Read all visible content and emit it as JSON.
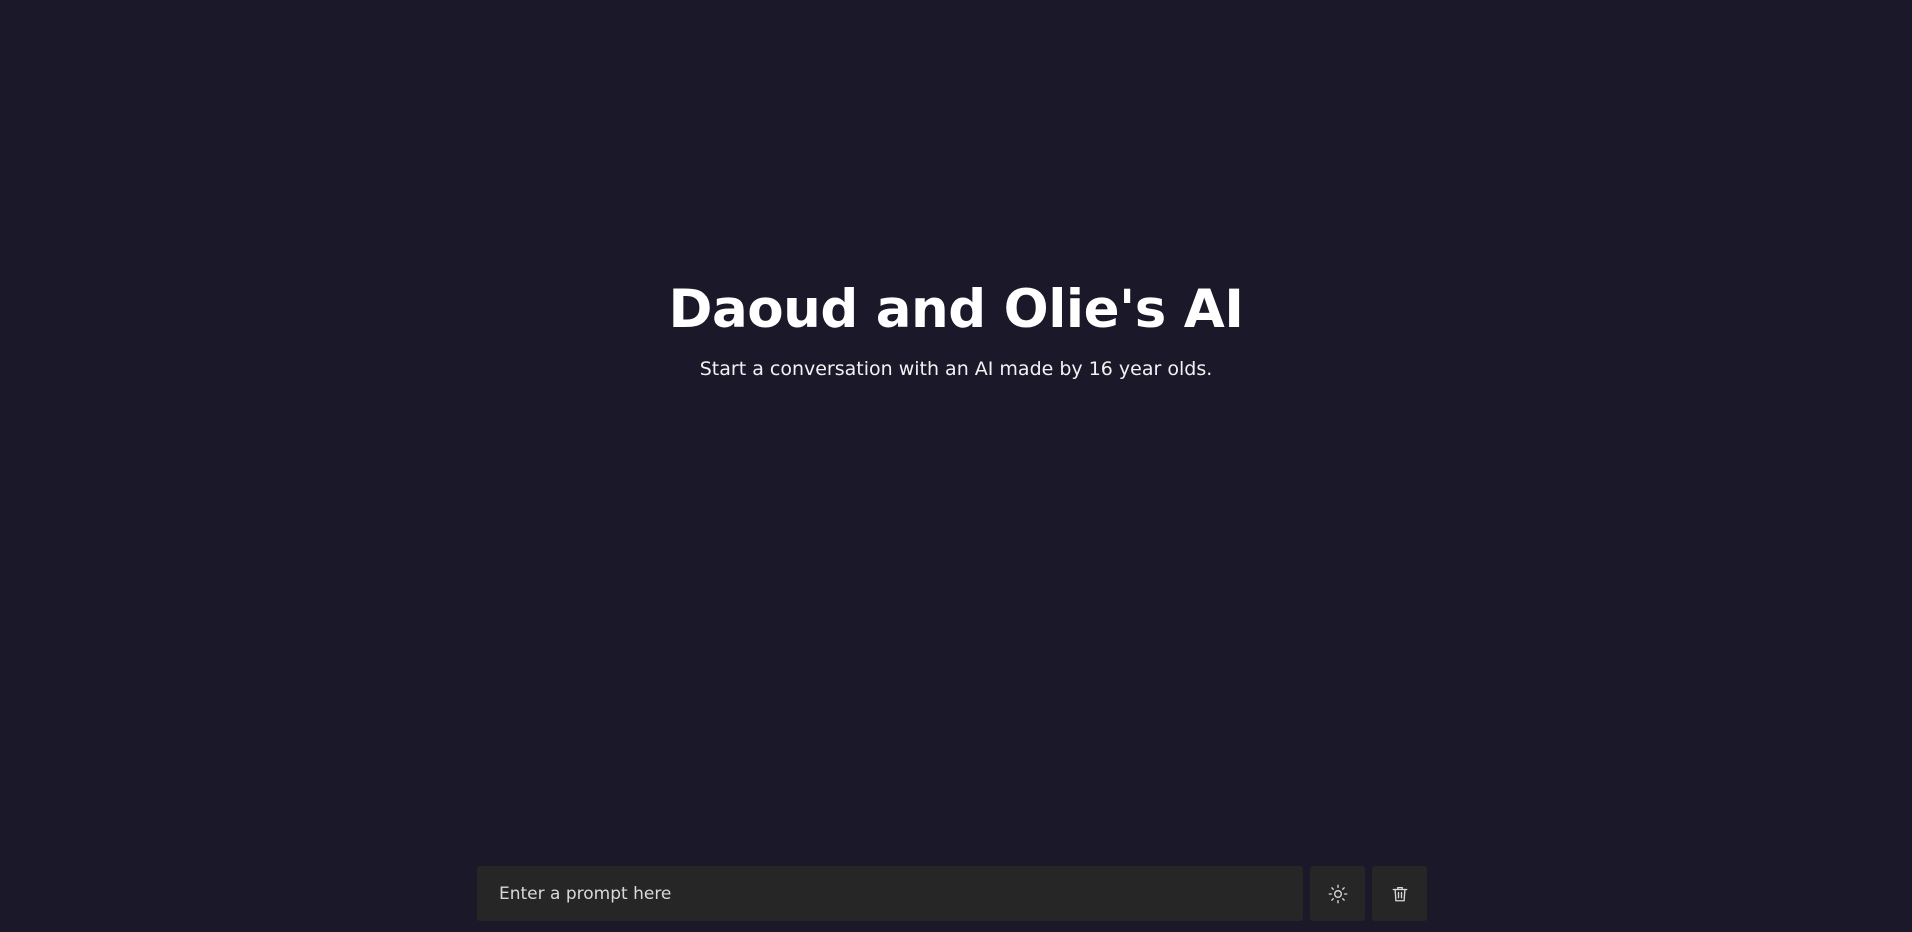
{
  "hero": {
    "title": "Daoud and Olie's AI",
    "subtitle": "Start a conversation with an AI made by 16 year olds."
  },
  "prompt": {
    "placeholder": "Enter a prompt here",
    "value": ""
  },
  "actions": {
    "theme_toggle_icon": "sun-icon",
    "delete_icon": "trash-icon"
  },
  "colors": {
    "background": "#1b182a",
    "input_background": "#262626",
    "text": "#ffffff"
  }
}
